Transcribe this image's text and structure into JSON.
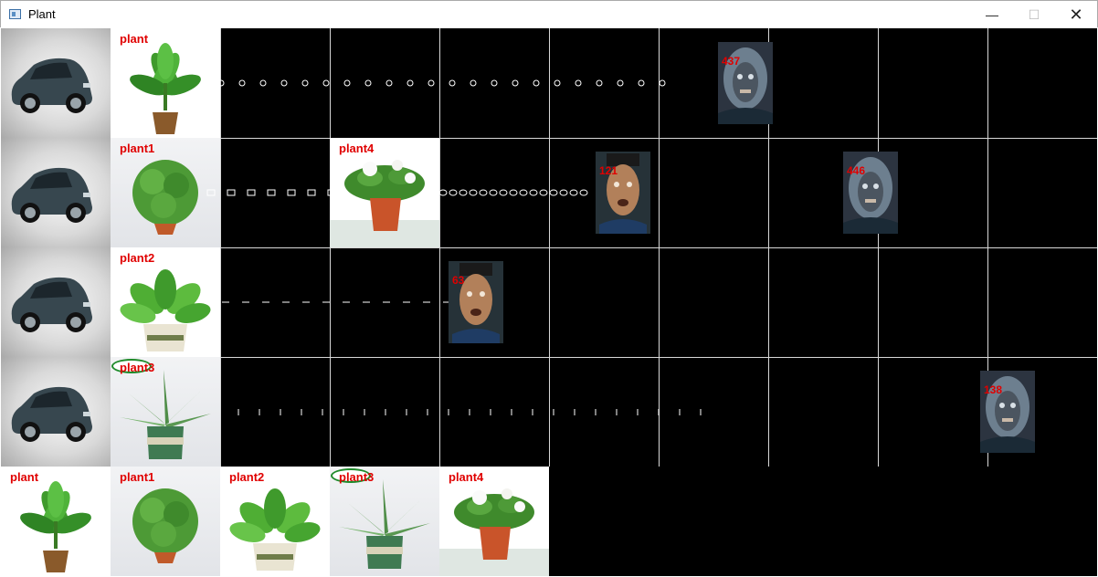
{
  "window": {
    "title": "Plant",
    "minimize": "—",
    "maximize": "☐",
    "close": "✕"
  },
  "colors": {
    "board_background": "#000000",
    "grid_lines": "#d8d8d8",
    "label_red": "#e00000",
    "badge_green": "#1f8a2a"
  },
  "lanes": [
    {
      "row": 1,
      "plant": "plant",
      "plant_col": 2,
      "projectile": "circle"
    },
    {
      "row": 2,
      "plant": "plant1",
      "plant_col": 2,
      "projectile": "square"
    },
    {
      "row": 3,
      "plant": "plant2",
      "plant_col": 2,
      "projectile": "dash"
    },
    {
      "row": 4,
      "plant": "plant3",
      "plant_col": 2,
      "projectile": "tick"
    }
  ],
  "extra_plant": {
    "label": "plant4",
    "row": 2,
    "col": 3
  },
  "zombies": [
    {
      "row": 1,
      "col": 6.5,
      "hp": "437",
      "kind": "gray-hair"
    },
    {
      "row": 2,
      "col": 5.5,
      "hp": "121",
      "kind": "jiangshi"
    },
    {
      "row": 2,
      "col": 8.5,
      "hp": "446",
      "kind": "gray-hair"
    },
    {
      "row": 3,
      "col": 4.5,
      "hp": "63",
      "kind": "jiangshi"
    },
    {
      "row": 4,
      "col": 9.5,
      "hp": "138",
      "kind": "gray-hair"
    }
  ],
  "card_bar": {
    "cards": [
      {
        "label": "plant"
      },
      {
        "label": "plant1"
      },
      {
        "label": "plant2"
      },
      {
        "label": "plant3"
      },
      {
        "label": "plant4"
      }
    ]
  },
  "labels": {
    "row1_plant": "plant",
    "row2_plant": "plant1",
    "row3_plant": "plant2",
    "row4_plant": "plant3",
    "row2_extra": "plant4",
    "z1": "437",
    "z2": "121",
    "z3": "446",
    "z4": "63",
    "z5": "138",
    "card0": "plant",
    "card1": "plant1",
    "card2": "plant2",
    "card3": "plant3",
    "card4": "plant4"
  }
}
